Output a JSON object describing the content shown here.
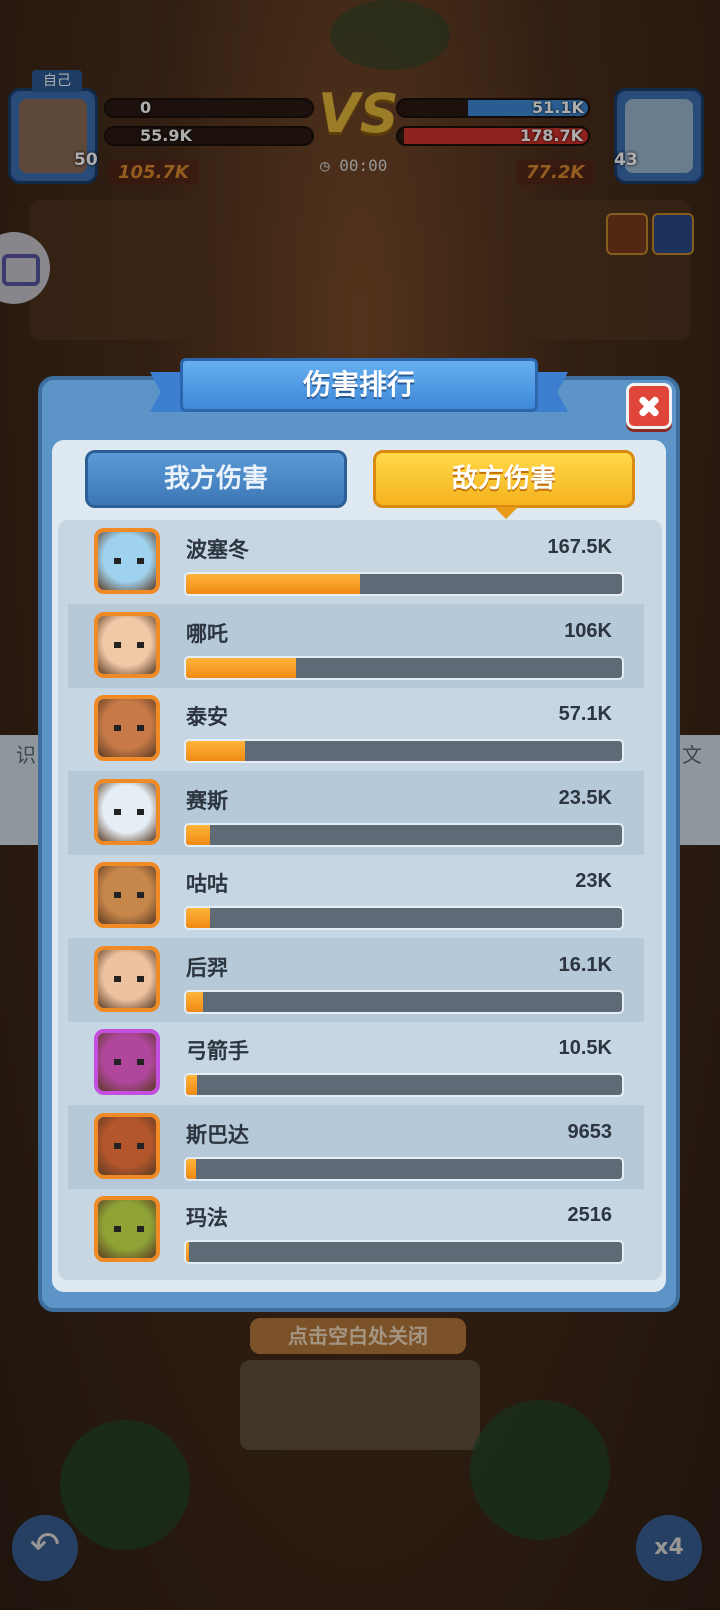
{
  "hud": {
    "self_tag": "自己",
    "self_level": "50",
    "enemy_level": "43",
    "self_tower_value": "0",
    "self_hp_value": "55.9K",
    "enemy_tower_value": "51.1K",
    "enemy_hp_value": "178.7K",
    "self_power": "105.7K",
    "enemy_power": "77.2K",
    "vs_label": "VS",
    "timer": "00:00"
  },
  "dialog": {
    "title": "伤害排行",
    "tab_ours": "我方伤害",
    "tab_enemy": "敌方伤害",
    "active_tab": "enemy"
  },
  "ranking": {
    "max_value": 167500,
    "rows": [
      {
        "name": "波塞冬",
        "value_label": "167.5K",
        "value": 167500,
        "skin": "#9fd2ee",
        "frame": "orange"
      },
      {
        "name": "哪吒",
        "value_label": "106K",
        "value": 106000,
        "skin": "#f1c9a7",
        "frame": "orange"
      },
      {
        "name": "泰安",
        "value_label": "57.1K",
        "value": 57100,
        "skin": "#c77a47",
        "frame": "orange"
      },
      {
        "name": "赛斯",
        "value_label": "23.5K",
        "value": 23500,
        "skin": "#e6eef5",
        "frame": "orange"
      },
      {
        "name": "咕咕",
        "value_label": "23K",
        "value": 23000,
        "skin": "#c7864a",
        "frame": "orange"
      },
      {
        "name": "后羿",
        "value_label": "16.1K",
        "value": 16100,
        "skin": "#edc2a0",
        "frame": "orange"
      },
      {
        "name": "弓箭手",
        "value_label": "10.5K",
        "value": 10500,
        "skin": "#b0479c",
        "frame": "purple"
      },
      {
        "name": "斯巴达",
        "value_label": "9653",
        "value": 9653,
        "skin": "#b3562c",
        "frame": "orange"
      },
      {
        "name": "玛法",
        "value_label": "2516",
        "value": 2516,
        "skin": "#8ea236",
        "frame": "orange"
      }
    ]
  },
  "footer": {
    "close_hint": "点击空白处关闭",
    "speed_label": "x4"
  },
  "side": {
    "left_tab": "识",
    "right_tab": "文"
  }
}
